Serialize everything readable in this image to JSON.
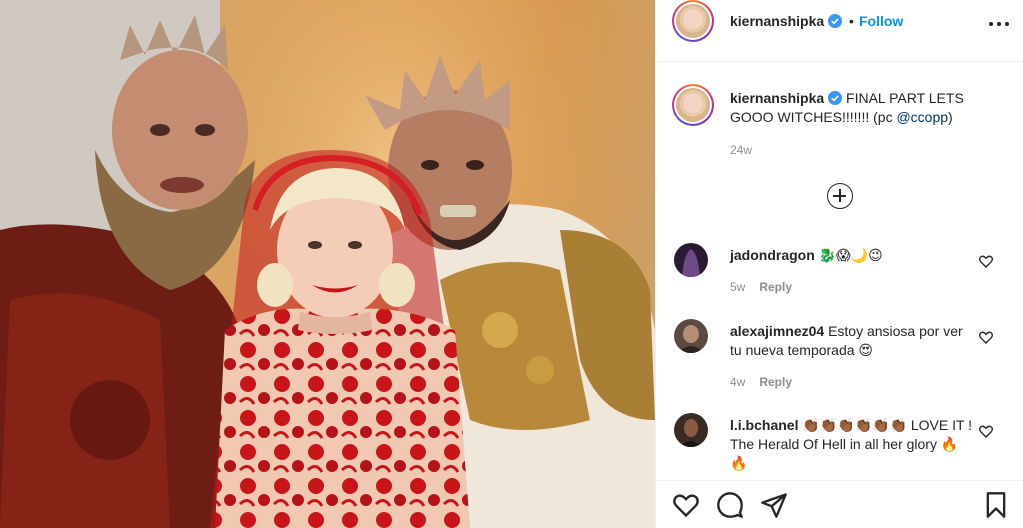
{
  "post": {
    "username": "kiernanshipka",
    "dot": "•",
    "follow_label": "Follow",
    "caption": {
      "text": " FINAL PART LETS GOOO WITCHES!!!!!!! (pc ",
      "mention": "@ccopp",
      "close": ")"
    },
    "time": "24w"
  },
  "comments": [
    {
      "username": "jadondragon",
      "text": "🐉😱🌙😉",
      "time": "5w",
      "reply_label": "Reply",
      "avatar_color": "#2b1a33"
    },
    {
      "username": "alexajimnez04",
      "text": "Estoy ansiosa por ver tu nueva temporada 😍",
      "time": "4w",
      "reply_label": "Reply",
      "avatar_color": "#5a4a42"
    },
    {
      "username": "l.i.bchanel",
      "text": "👏🏾👏🏾👏🏾👏🏾👏🏾👏🏾 LOVE IT ! The Herald Of Hell in all her glory 🔥🔥",
      "time": "",
      "reply_label": "",
      "avatar_color": "#3a2a24"
    }
  ],
  "icons": {
    "verified": "verified-badge-icon",
    "more": "more-options-icon",
    "add": "load-more-comments-icon",
    "like": "heart-icon",
    "comment": "comment-icon",
    "share": "share-icon",
    "save": "bookmark-icon"
  },
  "colors": {
    "accent": "#0095f6",
    "verified": "#3897f0",
    "meta": "#8e8e8e"
  }
}
